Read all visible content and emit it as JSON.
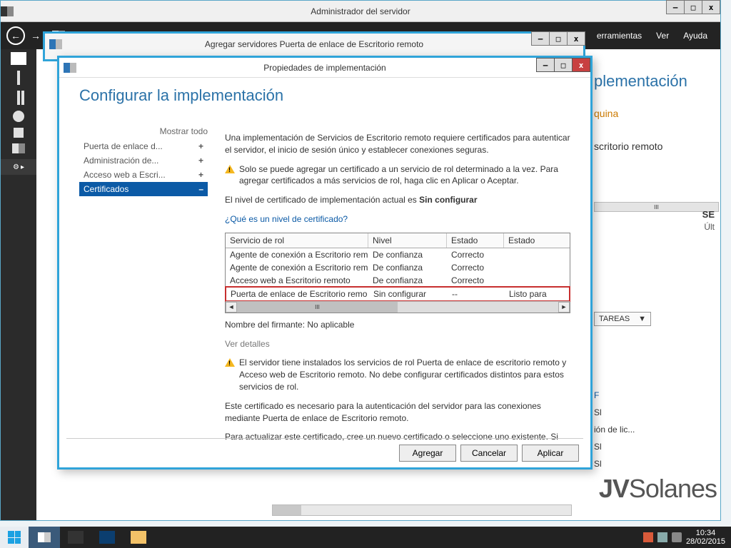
{
  "outer": {
    "title": "Administrador del servidor",
    "menu": {
      "tools": "erramientas",
      "view": "Ver",
      "help": "Ayuda"
    }
  },
  "mid": {
    "title": "Agregar servidores Puerta de enlace de Escritorio remoto"
  },
  "front": {
    "title": "Propiedades de implementación",
    "heading": "Configurar la implementación",
    "show_all": "Mostrar todo",
    "nav": {
      "gateway": "Puerta de enlace d...",
      "admin": "Administración de...",
      "web": "Acceso web a Escri...",
      "certs": "Certificados"
    },
    "para1": "Una implementación de Servicios de Escritorio remoto requiere certificados para autenticar el servidor, el inicio de sesión único y establecer conexiones seguras.",
    "warn1": "Solo se puede agregar un certificado a un servicio de rol determinado a la vez. Para agregar certificados a más servicios de rol, haga clic en Aplicar o Aceptar.",
    "level_pre": "El nivel de certificado de implementación actual es ",
    "level_val": "Sin configurar",
    "link_level": "¿Qué es un nivel de certificado?",
    "table": {
      "h1": "Servicio de rol",
      "h2": "Nivel",
      "h3": "Estado",
      "h4": "Estado",
      "rows": [
        {
          "c1": "Agente de conexión a Escritorio rem",
          "c2": "De confianza",
          "c3": "Correcto",
          "c4": ""
        },
        {
          "c1": "Agente de conexión a Escritorio rem",
          "c2": "De confianza",
          "c3": "Correcto",
          "c4": ""
        },
        {
          "c1": "Acceso web a Escritorio remoto",
          "c2": "De confianza",
          "c3": "Correcto",
          "c4": ""
        },
        {
          "c1": "Puerta de enlace de Escritorio remo",
          "c2": "Sin configurar",
          "c3": "--",
          "c4": "Listo para"
        }
      ]
    },
    "signer_pre": "Nombre del firmante: ",
    "signer_val": "No aplicable",
    "link_details": "Ver detalles",
    "warn2": "El servidor tiene instalados los servicios de rol Puerta de enlace de escritorio remoto y Acceso web de Escritorio remoto. No debe configurar certificados distintos para estos servicios de rol.",
    "para2": "Este certificado es necesario para la autenticación del servidor para las conexiones mediante Puerta de enlace de Escritorio remoto.",
    "para3": "Para actualizar este certificado, cree un nuevo certificado o seleccione uno existente. Si",
    "btn_add": "Agregar",
    "btn_cancel": "Cancelar",
    "btn_apply": "Aplicar"
  },
  "peek": {
    "h": "plementación",
    "link1": "quina",
    "link2": "scritorio remoto",
    "tareas": "TAREAS",
    "se": "SE",
    "ult": "Últ",
    "rows": [
      "F",
      "Sl",
      "ión de lic...",
      "Sl",
      "Sl"
    ]
  },
  "watermark": "Solanes",
  "taskbar": {
    "time": "10:34",
    "date": "28/02/2015"
  }
}
